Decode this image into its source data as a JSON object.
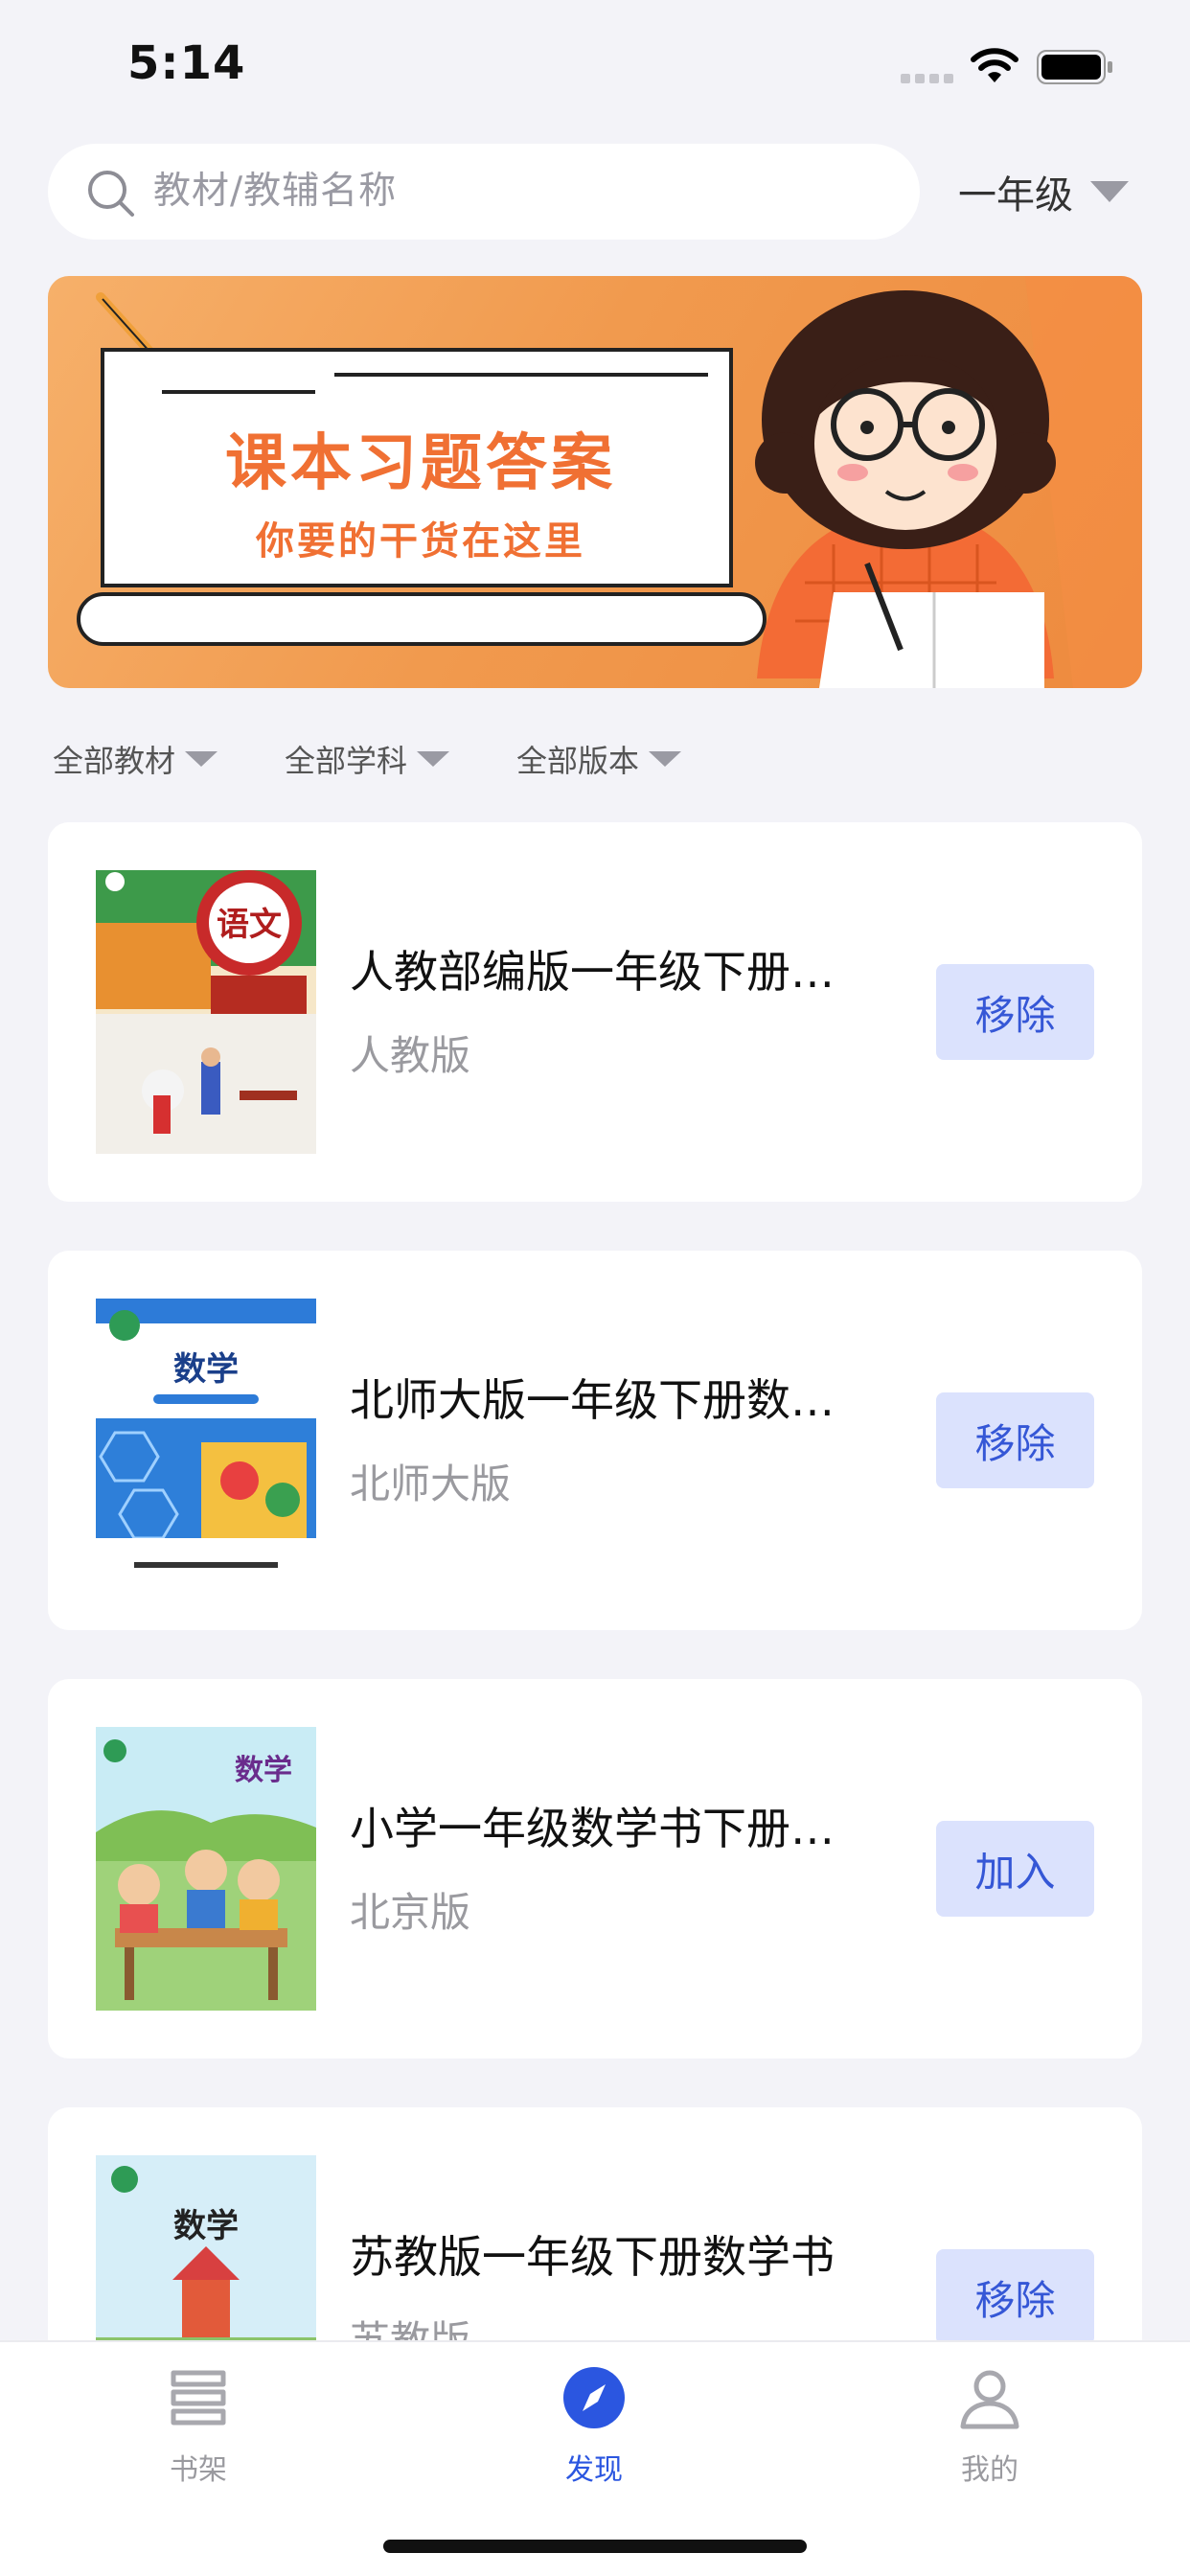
{
  "status_bar": {
    "time": "5:14"
  },
  "search": {
    "placeholder": "教材/教辅名称"
  },
  "grade_selector": {
    "label": "一年级"
  },
  "banner": {
    "title": "课本习题答案",
    "subtitle": "你要的干货在这里"
  },
  "filters": [
    {
      "label": "全部教材"
    },
    {
      "label": "全部学科"
    },
    {
      "label": "全部版本"
    }
  ],
  "books": [
    {
      "title": "人教部编版一年级下册…",
      "edition": "人教版",
      "action": "移除",
      "cover_text": "语文"
    },
    {
      "title": "北师大版一年级下册数…",
      "edition": "北师大版",
      "action": "移除",
      "cover_text": "数学"
    },
    {
      "title": "小学一年级数学书下册…",
      "edition": "北京版",
      "action": "加入",
      "cover_text": "数学"
    },
    {
      "title": "苏教版一年级下册数学书",
      "edition": "苏教版",
      "action": "移除",
      "cover_text": "数学"
    }
  ],
  "tab_bar": {
    "tabs": [
      {
        "label": "书架",
        "icon": "bookshelf-icon"
      },
      {
        "label": "发现",
        "icon": "compass-icon"
      },
      {
        "label": "我的",
        "icon": "user-icon"
      }
    ],
    "active": "发现"
  },
  "colors": {
    "accent": "#2b56e0",
    "button_bg": "#dbe2fd",
    "banner": "#f19a4e"
  }
}
